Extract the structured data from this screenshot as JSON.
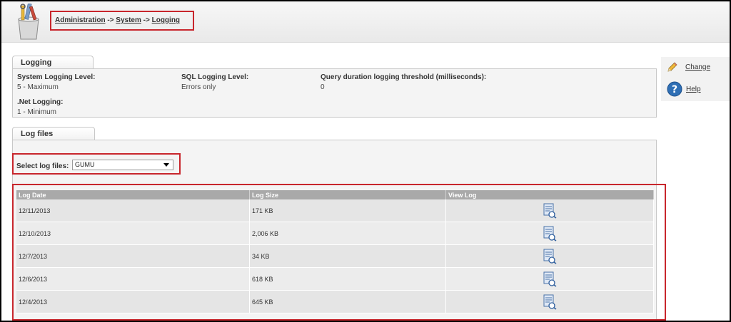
{
  "breadcrumb": {
    "items": [
      "Administration",
      "System",
      "Logging"
    ],
    "separator": "->"
  },
  "logging_panel": {
    "tab_label": "Logging",
    "system_logging_level": {
      "label": "System Logging Level:",
      "value": "5 - Maximum"
    },
    "sql_logging_level": {
      "label": "SQL Logging Level:",
      "value": "Errors only"
    },
    "query_duration": {
      "label": "Query duration logging threshold (milliseconds):",
      "value": "0"
    },
    "net_logging": {
      "label": ".Net Logging:",
      "value": "1 - Minimum"
    }
  },
  "log_files_panel": {
    "tab_label": "Log files",
    "select_label": "Select log files:",
    "select_value": "GUMU",
    "columns": [
      "Log Date",
      "Log Size",
      "View Log"
    ],
    "rows": [
      {
        "date": "12/11/2013",
        "size": "171 KB"
      },
      {
        "date": "12/10/2013",
        "size": "2,006 KB"
      },
      {
        "date": "12/7/2013",
        "size": "34 KB"
      },
      {
        "date": "12/6/2013",
        "size": "618 KB"
      },
      {
        "date": "12/4/2013",
        "size": "645 KB"
      }
    ]
  },
  "side_actions": {
    "change_label": "Change",
    "change_icon": "pencil-icon",
    "help_label": "Help",
    "help_icon": "help-icon"
  },
  "colors": {
    "highlight": "#c8262c",
    "grid_header": "#a9a9a9",
    "help_blue": "#2f6fb5"
  }
}
